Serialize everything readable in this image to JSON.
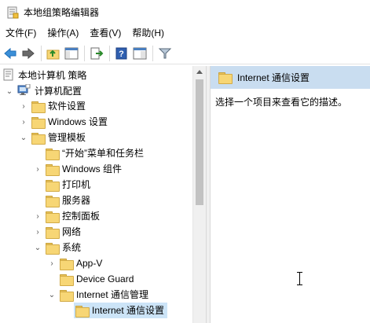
{
  "window": {
    "title": "本地组策略编辑器"
  },
  "menu": [
    "文件(F)",
    "操作(A)",
    "查看(V)",
    "帮助(H)"
  ],
  "toolbar": [
    {
      "icon": "back-arrow-icon"
    },
    {
      "icon": "forward-arrow-icon"
    },
    {
      "icon": "up-folder-icon"
    },
    {
      "icon": "show-hide-tree-icon"
    },
    {
      "icon": "export-list-icon"
    },
    {
      "icon": "help-icon"
    },
    {
      "icon": "properties-pane-icon"
    },
    {
      "icon": "filter-icon"
    }
  ],
  "tree": {
    "root": "本地计算机 策略",
    "computer_config": "计算机配置",
    "items": [
      {
        "label": "软件设置",
        "expand": "collapsed"
      },
      {
        "label": "Windows 设置",
        "expand": "collapsed"
      },
      {
        "label": "管理模板",
        "expand": "expanded"
      },
      {
        "label": "“开始”菜单和任务栏",
        "expand": "none"
      },
      {
        "label": "Windows 组件",
        "expand": "collapsed"
      },
      {
        "label": "打印机",
        "expand": "none"
      },
      {
        "label": "服务器",
        "expand": "none"
      },
      {
        "label": "控制面板",
        "expand": "collapsed"
      },
      {
        "label": "网络",
        "expand": "collapsed"
      },
      {
        "label": "系统",
        "expand": "expanded"
      },
      {
        "label": "App-V",
        "expand": "collapsed"
      },
      {
        "label": "Device Guard",
        "expand": "none"
      },
      {
        "label": "Internet 通信管理",
        "expand": "expanded"
      },
      {
        "label": "Internet 通信设置",
        "expand": "none",
        "selected": true
      }
    ]
  },
  "details": {
    "header": "Internet 通信设置",
    "description": "选择一个项目来查看它的描述。"
  },
  "colors": {
    "selection": "#cce4f7",
    "header_bg": "#c9ddf0",
    "folder": "#f7d675"
  }
}
